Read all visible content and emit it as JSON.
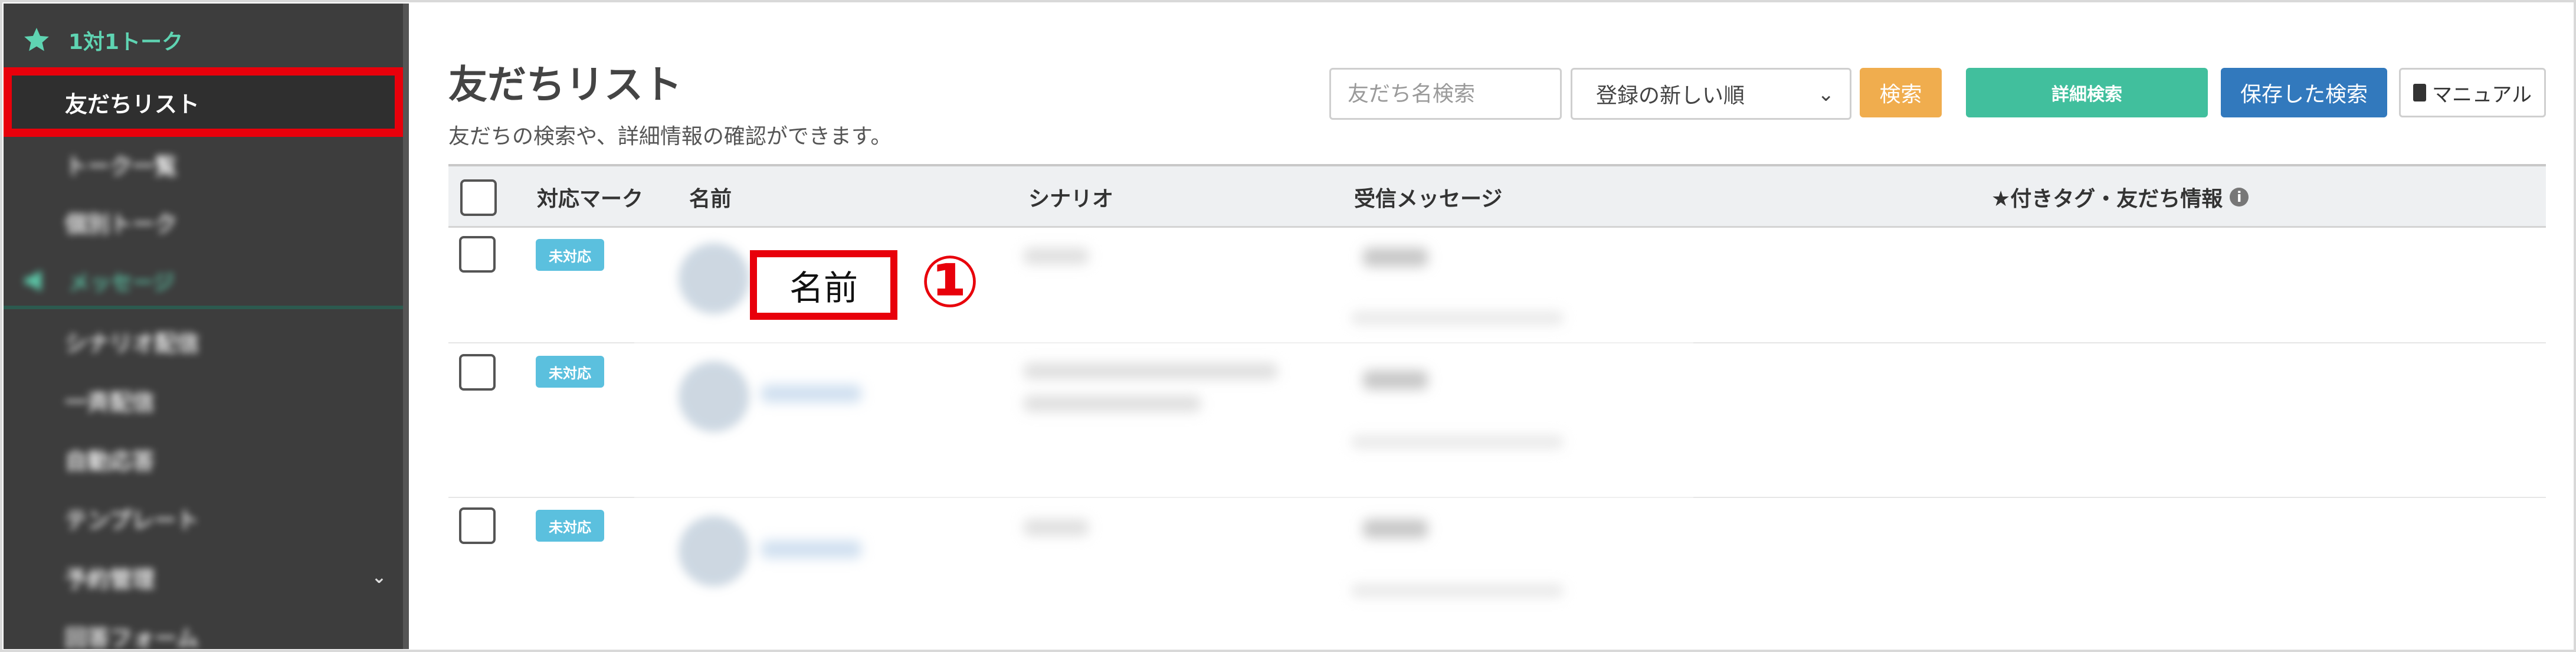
{
  "sidebar": {
    "section_talk": "1対1トーク",
    "items_talk": [
      "友だちリスト",
      "トーク一覧",
      "個別トーク"
    ],
    "section_message": "メッセージ",
    "items_message": [
      "シナリオ配信",
      "一斉配信",
      "自動応答",
      "テンプレート",
      "予約管理",
      "回答フォーム"
    ],
    "accent_color": "#5fd4b2"
  },
  "header": {
    "title": "友だちリスト",
    "subtitle": "友だちの検索や、詳細情報の確認ができます。"
  },
  "toolbar": {
    "search_placeholder": "友だち名検索",
    "sort_selected": "登録の新しい順",
    "search_button": "検索",
    "detail_search_button": "詳細検索",
    "saved_search_button": "保存した検索",
    "manual_button": "マニュアル"
  },
  "table": {
    "columns": [
      "対応マーク",
      "名前",
      "シナリオ",
      "受信メッセージ",
      "★付きタグ・友だち情報"
    ],
    "rows": [
      {
        "status": "未対応"
      },
      {
        "status": "未対応"
      },
      {
        "status": "未対応"
      }
    ]
  },
  "annotation": {
    "label": "名前",
    "number": "①"
  }
}
